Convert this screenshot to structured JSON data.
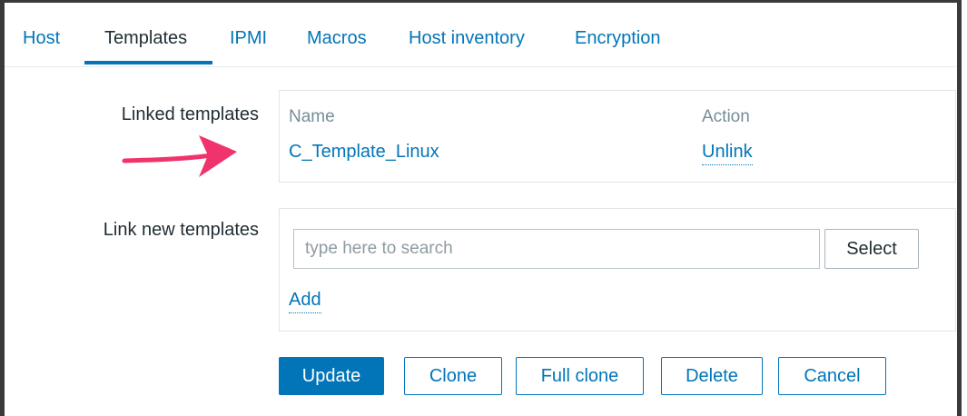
{
  "tabs": [
    {
      "label": "Host"
    },
    {
      "label": "Templates"
    },
    {
      "label": "IPMI"
    },
    {
      "label": "Macros"
    },
    {
      "label": "Host inventory"
    },
    {
      "label": "Encryption"
    }
  ],
  "linked_templates": {
    "label": "Linked templates",
    "columns": {
      "name": "Name",
      "action": "Action"
    },
    "rows": [
      {
        "name": "C_Template_Linux",
        "action": "Unlink"
      }
    ]
  },
  "link_new_templates": {
    "label": "Link new templates",
    "search_placeholder": "type here to search",
    "search_value": "",
    "select_label": "Select",
    "add_label": "Add"
  },
  "actions": {
    "update": "Update",
    "clone": "Clone",
    "full_clone": "Full clone",
    "delete": "Delete",
    "cancel": "Cancel"
  },
  "annotation": {
    "arrow_icon": "arrow-right-icon",
    "arrow_color": "#f0346b"
  },
  "colors": {
    "accent": "#0275b8",
    "text": "#1f2c33",
    "muted": "#768d99"
  }
}
